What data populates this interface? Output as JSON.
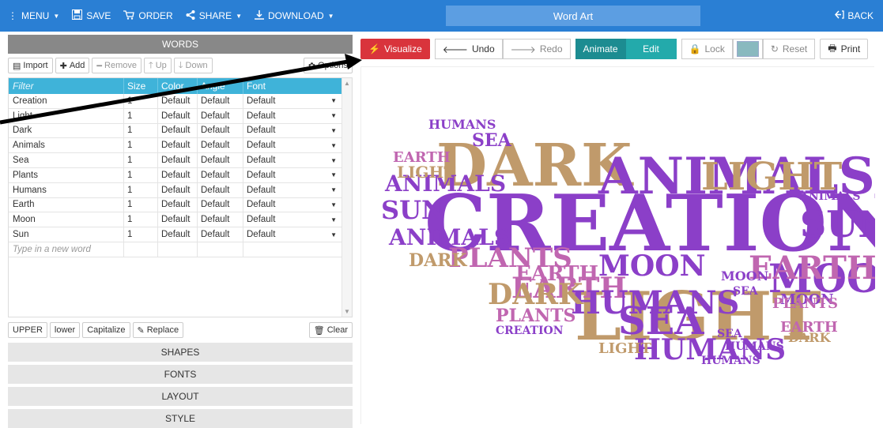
{
  "topbar": {
    "menu": "MENU",
    "save": "SAVE",
    "order": "ORDER",
    "share": "SHARE",
    "download": "DOWNLOAD",
    "title": "Word Art",
    "back": "BACK",
    "color": "#2a7fd4"
  },
  "words_panel": {
    "heading": "WORDS",
    "toolbar": {
      "import": "Import",
      "add": "Add",
      "remove": "Remove",
      "up": "Up",
      "down": "Down",
      "options": "Options"
    },
    "columns": [
      "Filter",
      "Size",
      "Color",
      "Angle",
      "Font"
    ],
    "rows": [
      {
        "word": "Creation",
        "size": "1",
        "color": "Default",
        "angle": "Default",
        "font": "Default"
      },
      {
        "word": "Light",
        "size": "1",
        "color": "Default",
        "angle": "Default",
        "font": "Default"
      },
      {
        "word": "Dark",
        "size": "1",
        "color": "Default",
        "angle": "Default",
        "font": "Default"
      },
      {
        "word": "Animals",
        "size": "1",
        "color": "Default",
        "angle": "Default",
        "font": "Default"
      },
      {
        "word": "Sea",
        "size": "1",
        "color": "Default",
        "angle": "Default",
        "font": "Default"
      },
      {
        "word": "Plants",
        "size": "1",
        "color": "Default",
        "angle": "Default",
        "font": "Default"
      },
      {
        "word": "Humans",
        "size": "1",
        "color": "Default",
        "angle": "Default",
        "font": "Default"
      },
      {
        "word": "Earth",
        "size": "1",
        "color": "Default",
        "angle": "Default",
        "font": "Default"
      },
      {
        "word": "Moon",
        "size": "1",
        "color": "Default",
        "angle": "Default",
        "font": "Default"
      },
      {
        "word": "Sun",
        "size": "1",
        "color": "Default",
        "angle": "Default",
        "font": "Default"
      }
    ],
    "new_word_placeholder": "Type in a new word",
    "bottom": {
      "upper": "UPPER",
      "lower": "lower",
      "capitalize": "Capitalize",
      "replace": "Replace",
      "clear": "Clear"
    }
  },
  "sections": [
    "SHAPES",
    "FONTS",
    "LAYOUT",
    "STYLE"
  ],
  "canvas_toolbar": {
    "visualize": "Visualize",
    "undo": "Undo",
    "redo": "Redo",
    "animate": "Animate",
    "edit": "Edit",
    "lock": "Lock",
    "reset": "Reset",
    "print": "Print"
  },
  "wordcloud": [
    {
      "text": "CREATION",
      "color": "#8b3fc8"
    },
    {
      "text": "LIGHT",
      "color": "#c09a6b"
    },
    {
      "text": "DARK",
      "color": "#c09a6b"
    },
    {
      "text": "SEA",
      "color": "#8b3fc8"
    },
    {
      "text": "ANIMALS",
      "color": "#8b3fc8"
    },
    {
      "text": "MOON",
      "color": "#8b3fc8"
    },
    {
      "text": "SUN",
      "color": "#8b3fc8"
    },
    {
      "text": "PLANTS",
      "color": "#c066b0"
    },
    {
      "text": "HUMANS",
      "color": "#8b3fc8"
    },
    {
      "text": "EARTH",
      "color": "#c066b0"
    }
  ]
}
